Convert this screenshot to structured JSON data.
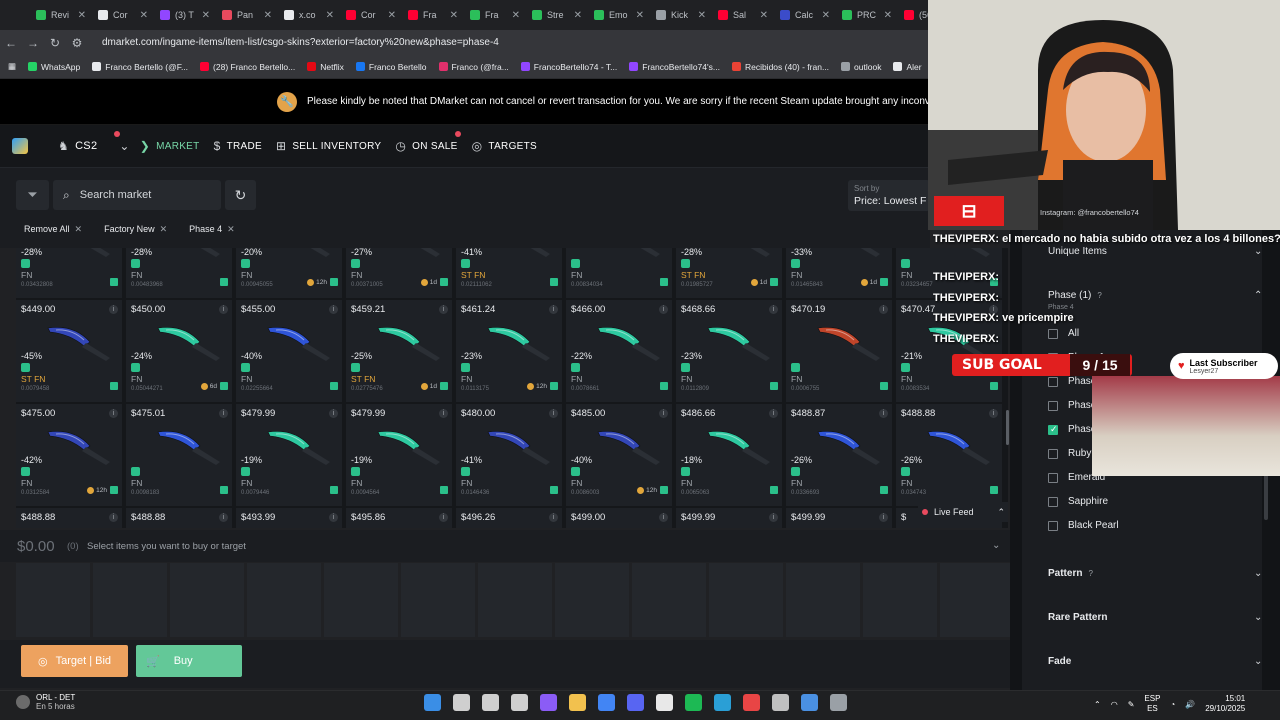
{
  "browser": {
    "tabs": [
      {
        "label": "Revi",
        "color": "#2bbf5a"
      },
      {
        "label": "Cor",
        "color": "#e8eaed"
      },
      {
        "label": "(3) T",
        "color": "#9146ff"
      },
      {
        "label": "Pan",
        "color": "#e94a5e"
      },
      {
        "label": "x.co",
        "color": "#e8eaed"
      },
      {
        "label": "Cor",
        "color": "#ff0033"
      },
      {
        "label": "Fra",
        "color": "#ff0033"
      },
      {
        "label": "Fra",
        "color": "#2bbf5a"
      },
      {
        "label": "Stre",
        "color": "#2bbf5a"
      },
      {
        "label": "Emo",
        "color": "#2bbf5a"
      },
      {
        "label": "Kick",
        "color": "#9aa0a6"
      },
      {
        "label": "Sal",
        "color": "#ff0033"
      },
      {
        "label": "Calc",
        "color": "#3b4cca"
      },
      {
        "label": "PRC",
        "color": "#2bbf5a"
      },
      {
        "label": "(56)",
        "color": "#ff0033"
      }
    ],
    "url": "dmarket.com/ingame-items/item-list/csgo-skins?exterior=factory%20new&phase=phase-4",
    "bookmarks": [
      {
        "label": "WhatsApp",
        "color": "#25d366"
      },
      {
        "label": "Franco Bertello (@F...",
        "color": "#e8eaed"
      },
      {
        "label": "(28) Franco Bertello...",
        "color": "#ff0033"
      },
      {
        "label": "Netflix",
        "color": "#e50914"
      },
      {
        "label": "Franco Bertello",
        "color": "#1877f2"
      },
      {
        "label": "Franco (@fra...",
        "color": "#e1306c"
      },
      {
        "label": "FrancoBertello74 - T...",
        "color": "#9146ff"
      },
      {
        "label": "FrancoBertello74's...",
        "color": "#9146ff"
      },
      {
        "label": "Recibidos (40) - fran...",
        "color": "#ea4335"
      },
      {
        "label": "outlook",
        "color": "#9aa0a6"
      },
      {
        "label": "Aler",
        "color": "#e8eaed"
      }
    ]
  },
  "notice": "Please kindly be noted that DMarket can not cancel or revert transaction for you. We are sorry if the recent Steam update brought any inconve",
  "nav": {
    "game": "CS2",
    "market": "MARKET",
    "trade": "TRADE",
    "sell": "SELL INVENTORY",
    "onsale": "ON SALE",
    "targets": "TARGETS"
  },
  "toolbar": {
    "search_placeholder": "Search market",
    "sort_label": "Sort by",
    "sort_value": "Price: Lowest F",
    "chips": [
      "Remove All",
      "Factory New",
      "Phase 4"
    ]
  },
  "rows": [
    {
      "top_price": null,
      "cards": [
        {
          "price": "",
          "disc": "-28%",
          "ext": "FN",
          "st": false,
          "float": "0.03432808",
          "hold": "",
          "color": "#2aa87a"
        },
        {
          "price": "",
          "disc": "-28%",
          "ext": "FN",
          "st": false,
          "float": "0.00483968",
          "hold": "",
          "color": "#2aa87a"
        },
        {
          "price": "",
          "disc": "-20%",
          "ext": "FN",
          "st": false,
          "float": "0.00945055",
          "hold": "12h",
          "color": "#5c6064"
        },
        {
          "price": "",
          "disc": "-27%",
          "ext": "FN",
          "st": false,
          "float": "0.00371005",
          "hold": "1d",
          "color": "#2aa87a"
        },
        {
          "price": "",
          "disc": "-41%",
          "ext": "ST FN",
          "st": true,
          "float": "0.02111062",
          "hold": "",
          "color": "#3a4bb0"
        },
        {
          "price": "",
          "disc": "",
          "ext": "FN",
          "st": false,
          "float": "0.00834034",
          "hold": "",
          "color": "#c4a93a"
        },
        {
          "price": "",
          "disc": "-28%",
          "ext": "ST FN",
          "st": true,
          "float": "0.01985727",
          "hold": "1d",
          "color": "#6b7a48"
        },
        {
          "price": "",
          "disc": "-33%",
          "ext": "FN",
          "st": false,
          "float": "0.01465843",
          "hold": "1d",
          "color": "#6b7a48"
        },
        {
          "price": "",
          "disc": "",
          "ext": "FN",
          "st": false,
          "float": "0.03234657",
          "hold": "",
          "color": "#2aa87a"
        }
      ]
    },
    {
      "cards": [
        {
          "price": "$449.00",
          "disc": "-45%",
          "ext": "ST FN",
          "st": true,
          "float": "0.0079458",
          "hold": "",
          "color": "#3347b8"
        },
        {
          "price": "$450.00",
          "disc": "-24%",
          "ext": "FN",
          "st": false,
          "float": "0.05044271",
          "hold": "6d",
          "color": "#2ec9a0"
        },
        {
          "price": "$455.00",
          "disc": "-40%",
          "ext": "FN",
          "st": false,
          "float": "0.02255664",
          "hold": "",
          "color": "#2f55d8"
        },
        {
          "price": "$459.21",
          "disc": "-25%",
          "ext": "ST FN",
          "st": true,
          "float": "0.02775476",
          "hold": "1d",
          "color": "#2ec9a0"
        },
        {
          "price": "$461.24",
          "disc": "-23%",
          "ext": "FN",
          "st": false,
          "float": "0.0113175",
          "hold": "12h",
          "color": "#2ec9a0"
        },
        {
          "price": "$466.00",
          "disc": "-22%",
          "ext": "FN",
          "st": false,
          "float": "0.0078661",
          "hold": "",
          "color": "#2ec9a0"
        },
        {
          "price": "$468.66",
          "disc": "-23%",
          "ext": "FN",
          "st": false,
          "float": "0.0112809",
          "hold": "",
          "color": "#2ec9a0"
        },
        {
          "price": "$470.19",
          "disc": "",
          "ext": "FN",
          "st": false,
          "float": "0.0006755",
          "hold": "",
          "color": "#c0452a"
        },
        {
          "price": "$470.47",
          "disc": "-21%",
          "ext": "FN",
          "st": false,
          "float": "0.0083534",
          "hold": "",
          "color": "#2ec9a0"
        }
      ]
    },
    {
      "cards": [
        {
          "price": "$475.00",
          "disc": "-42%",
          "ext": "FN",
          "st": false,
          "float": "0.0312584",
          "hold": "12h",
          "color": "#3347b8"
        },
        {
          "price": "$475.01",
          "disc": "",
          "ext": "FN",
          "st": false,
          "float": "0.0098183",
          "hold": "",
          "color": "#2f55d8"
        },
        {
          "price": "$479.99",
          "disc": "-19%",
          "ext": "FN",
          "st": false,
          "float": "0.0079446",
          "hold": "",
          "color": "#2ec9a0"
        },
        {
          "price": "$479.99",
          "disc": "-19%",
          "ext": "FN",
          "st": false,
          "float": "0.0094564",
          "hold": "",
          "color": "#2ec9a0"
        },
        {
          "price": "$480.00",
          "disc": "-41%",
          "ext": "FN",
          "st": false,
          "float": "0.0146436",
          "hold": "",
          "color": "#3347b8"
        },
        {
          "price": "$485.00",
          "disc": "-40%",
          "ext": "FN",
          "st": false,
          "float": "0.0086003",
          "hold": "12h",
          "color": "#3347b8"
        },
        {
          "price": "$486.66",
          "disc": "-18%",
          "ext": "FN",
          "st": false,
          "float": "0.0065063",
          "hold": "",
          "color": "#2ec9a0"
        },
        {
          "price": "$488.87",
          "disc": "-26%",
          "ext": "FN",
          "st": false,
          "float": "0.0336693",
          "hold": "",
          "color": "#2f55d8"
        },
        {
          "price": "$488.88",
          "disc": "-26%",
          "ext": "FN",
          "st": false,
          "float": "0.034743",
          "hold": "",
          "color": "#2f55d8"
        }
      ]
    },
    {
      "cards": [
        {
          "price": "$488.88"
        },
        {
          "price": "$488.88"
        },
        {
          "price": "$493.99"
        },
        {
          "price": "$495.86"
        },
        {
          "price": "$496.26"
        },
        {
          "price": "$499.00"
        },
        {
          "price": "$499.99"
        },
        {
          "price": "$499.99"
        },
        {
          "price": "$"
        }
      ]
    }
  ],
  "livefeed": "Live Feed",
  "cart": {
    "total": "$0.00",
    "count": "(0)",
    "hint": "Select items you want to buy or target",
    "target_label": "Target | Bid",
    "buy_label": "Buy"
  },
  "filters": {
    "unique": "Unique Items",
    "phase_title": "Phase (1)",
    "phase_selected": "Phase 4",
    "options": [
      {
        "label": "All",
        "checked": false
      },
      {
        "label": "Phase 1",
        "checked": false
      },
      {
        "label": "Phase 2",
        "checked": false
      },
      {
        "label": "Phase 3",
        "checked": false
      },
      {
        "label": "Phase 4",
        "checked": true
      },
      {
        "label": "Ruby",
        "checked": false
      },
      {
        "label": "Emerald",
        "checked": false
      },
      {
        "label": "Sapphire",
        "checked": false
      },
      {
        "label": "Black Pearl",
        "checked": false
      }
    ],
    "pattern": "Pattern",
    "rare": "Rare Pattern",
    "fade": "Fade"
  },
  "stream": {
    "instagram": "Instagram: @francobertello74",
    "chat": [
      {
        "user": "THEVIPERX",
        "text": ": el mercado no habia subido otra vez a los 4 billones?"
      },
      {
        "user": "THEVIPERX",
        "text": ":"
      },
      {
        "user": "THEVIPERX",
        "text": ":"
      },
      {
        "user": "THEVIPERX",
        "text": ": ve pricempire"
      },
      {
        "user": "THEVIPERX",
        "text": ":"
      }
    ],
    "goal_label": "SUB GOAL",
    "goal_count": "9 / 15",
    "last_sub_title": "Last Subscriber",
    "last_sub_name": "Lesyer27"
  },
  "taskbar": {
    "weather_t1": "ORL - DET",
    "weather_t2": "En 5 horas",
    "lang1": "ESP",
    "lang2": "ES",
    "time": "15:01",
    "date": "29/10/2025",
    "icons": [
      "#3a8ee6",
      "#cfcfcf",
      "#cfcfcf",
      "#cfcfcf",
      "#8b5cf6",
      "#f2c14e",
      "#4285f4",
      "#5865f2",
      "#e8e8e8",
      "#1db954",
      "#2a9fd6",
      "#e84545",
      "#c0c0c0",
      "#4a90e2",
      "#9aa0a6"
    ]
  }
}
